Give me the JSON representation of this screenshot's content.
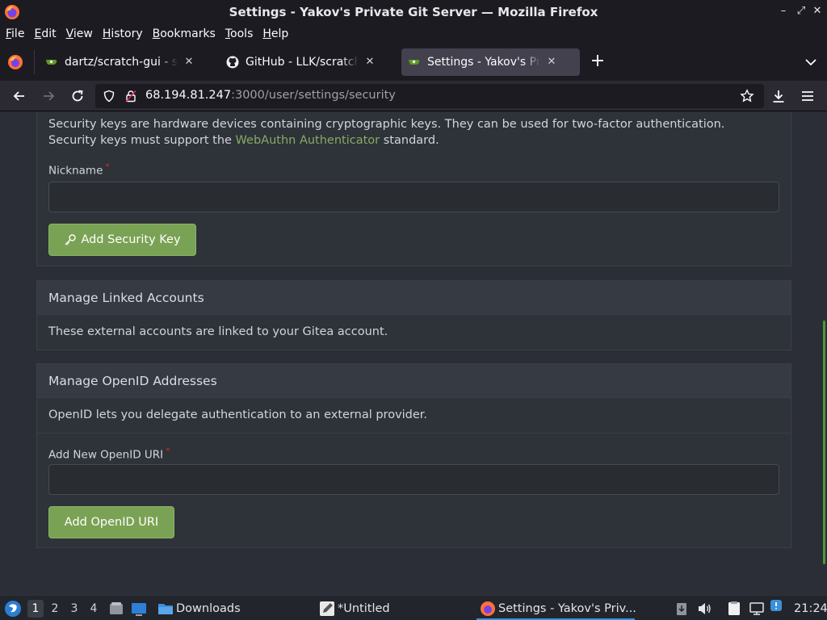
{
  "window": {
    "title": "Settings - Yakov's Private Git Server — Mozilla Firefox",
    "controls": [
      "minimize-icon",
      "restore-icon",
      "close-icon"
    ]
  },
  "menubar": {
    "items": [
      "File",
      "Edit",
      "View",
      "History",
      "Bookmarks",
      "Tools",
      "Help"
    ]
  },
  "tabs": [
    {
      "label": "dartz/scratch-gui - scratch-gui",
      "favicon": "gitea-icon",
      "active": false
    },
    {
      "label": "GitHub - LLK/scratch-gui",
      "favicon": "github-icon",
      "active": false
    },
    {
      "label": "Settings - Yakov's Private Git Server",
      "favicon": "gitea-icon",
      "active": true
    }
  ],
  "navbar": {
    "url_host": "68.194.81.247",
    "url_rest": ":3000/user/settings/security"
  },
  "content": {
    "security_keys": {
      "description_pre": "Security keys are hardware devices containing cryptographic keys. They can be used for two-factor authentication. Security keys must support the ",
      "description_link": "WebAuthn Authenticator",
      "description_post": " standard.",
      "nickname_label": "Nickname",
      "required_mark": "*",
      "add_button": "Add Security Key"
    },
    "linked_accounts": {
      "title": "Manage Linked Accounts",
      "description": "These external accounts are linked to your Gitea account."
    },
    "openid": {
      "title": "Manage OpenID Addresses",
      "description": "OpenID lets you delegate authentication to an external provider.",
      "uri_label": "Add New OpenID URI",
      "required_mark": "*",
      "add_button": "Add OpenID URI"
    }
  },
  "taskbar": {
    "workspaces": [
      "1",
      "2",
      "3",
      "4"
    ],
    "active_workspace": "1",
    "downloads_label": "Downloads",
    "editor_label": "*Untitled",
    "firefox_label": "Settings - Yakov's Priv...",
    "clock": "21:24"
  },
  "colors": {
    "accent_green": "#7aa254",
    "link_green": "#87ab63",
    "required_red": "#db2828",
    "page_bg": "#2b2e36"
  }
}
